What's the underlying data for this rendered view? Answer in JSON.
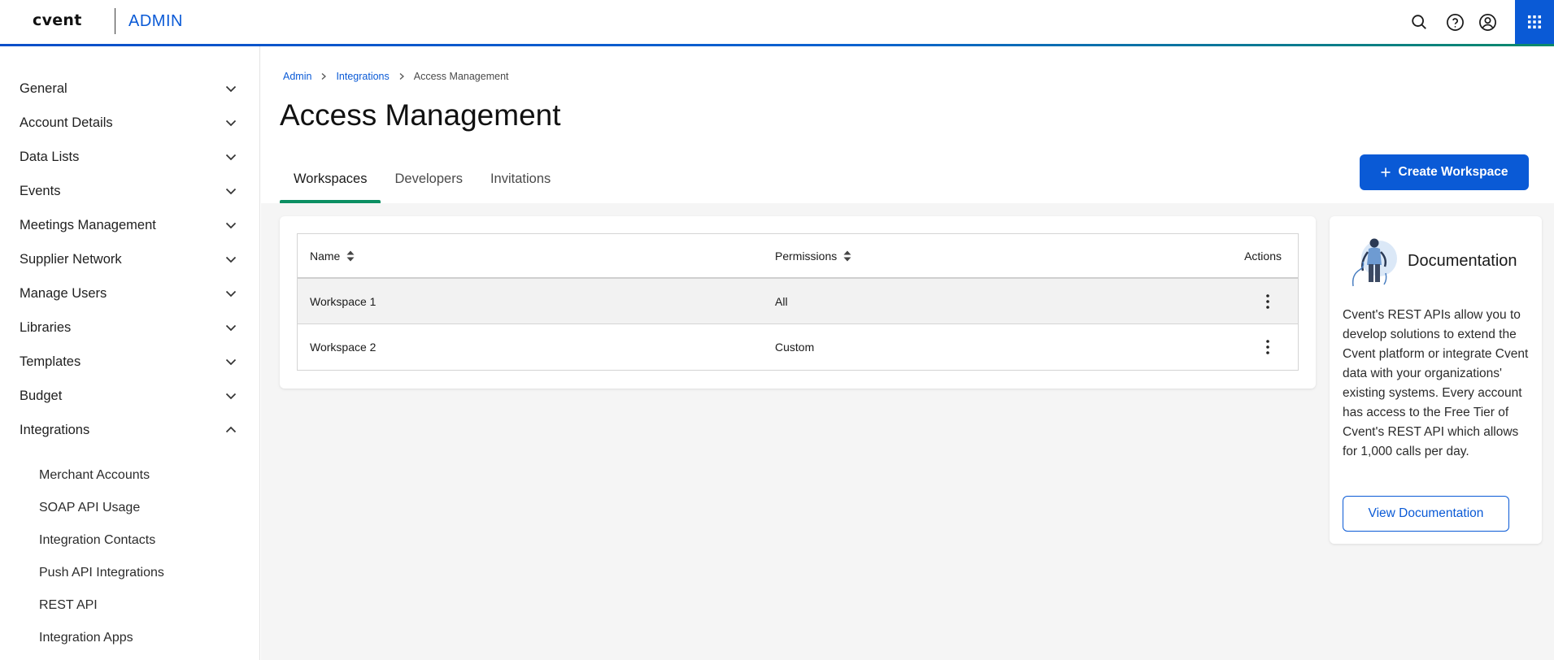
{
  "header": {
    "logo_text": "cvent",
    "app_label": "ADMIN",
    "icons": [
      "search-icon",
      "help-icon",
      "user-icon",
      "apps-grid-icon"
    ],
    "accent_color": "#0a5ad6"
  },
  "sidebar": {
    "items": [
      {
        "label": "General",
        "expanded": false
      },
      {
        "label": "Account Details",
        "expanded": false
      },
      {
        "label": "Data Lists",
        "expanded": false
      },
      {
        "label": "Events",
        "expanded": false
      },
      {
        "label": "Meetings Management",
        "expanded": false
      },
      {
        "label": "Supplier Network",
        "expanded": false
      },
      {
        "label": "Manage Users",
        "expanded": false
      },
      {
        "label": "Libraries",
        "expanded": false
      },
      {
        "label": "Templates",
        "expanded": false
      },
      {
        "label": "Budget",
        "expanded": false
      },
      {
        "label": "Integrations",
        "expanded": true
      }
    ],
    "sub_items": [
      {
        "label": "Merchant Accounts"
      },
      {
        "label": "SOAP API Usage"
      },
      {
        "label": "Integration Contacts"
      },
      {
        "label": "Push API Integrations"
      },
      {
        "label": "REST API"
      },
      {
        "label": "Integration Apps"
      }
    ]
  },
  "breadcrumb": {
    "items": [
      "Admin",
      "Integrations"
    ],
    "current": "Access Management"
  },
  "page": {
    "title": "Access Management",
    "tabs": [
      {
        "label": "Workspaces",
        "active": true
      },
      {
        "label": "Developers",
        "active": false
      },
      {
        "label": "Invitations",
        "active": false
      }
    ],
    "create_button_label": "Create Workspace"
  },
  "table": {
    "columns": [
      "Name",
      "Permissions",
      "Actions"
    ],
    "rows": [
      {
        "name": "Workspace 1",
        "permissions": "All"
      },
      {
        "name": "Workspace 2",
        "permissions": "Custom"
      }
    ]
  },
  "documentation": {
    "title": "Documentation",
    "body": "Cvent's REST APIs allow you to develop solutions to extend the Cvent platform or integrate Cvent data with your organizations' existing systems. Every account has access to the Free Tier of Cvent's REST API which allows for 1,000 calls per day.",
    "button_label": "View Documentation"
  }
}
